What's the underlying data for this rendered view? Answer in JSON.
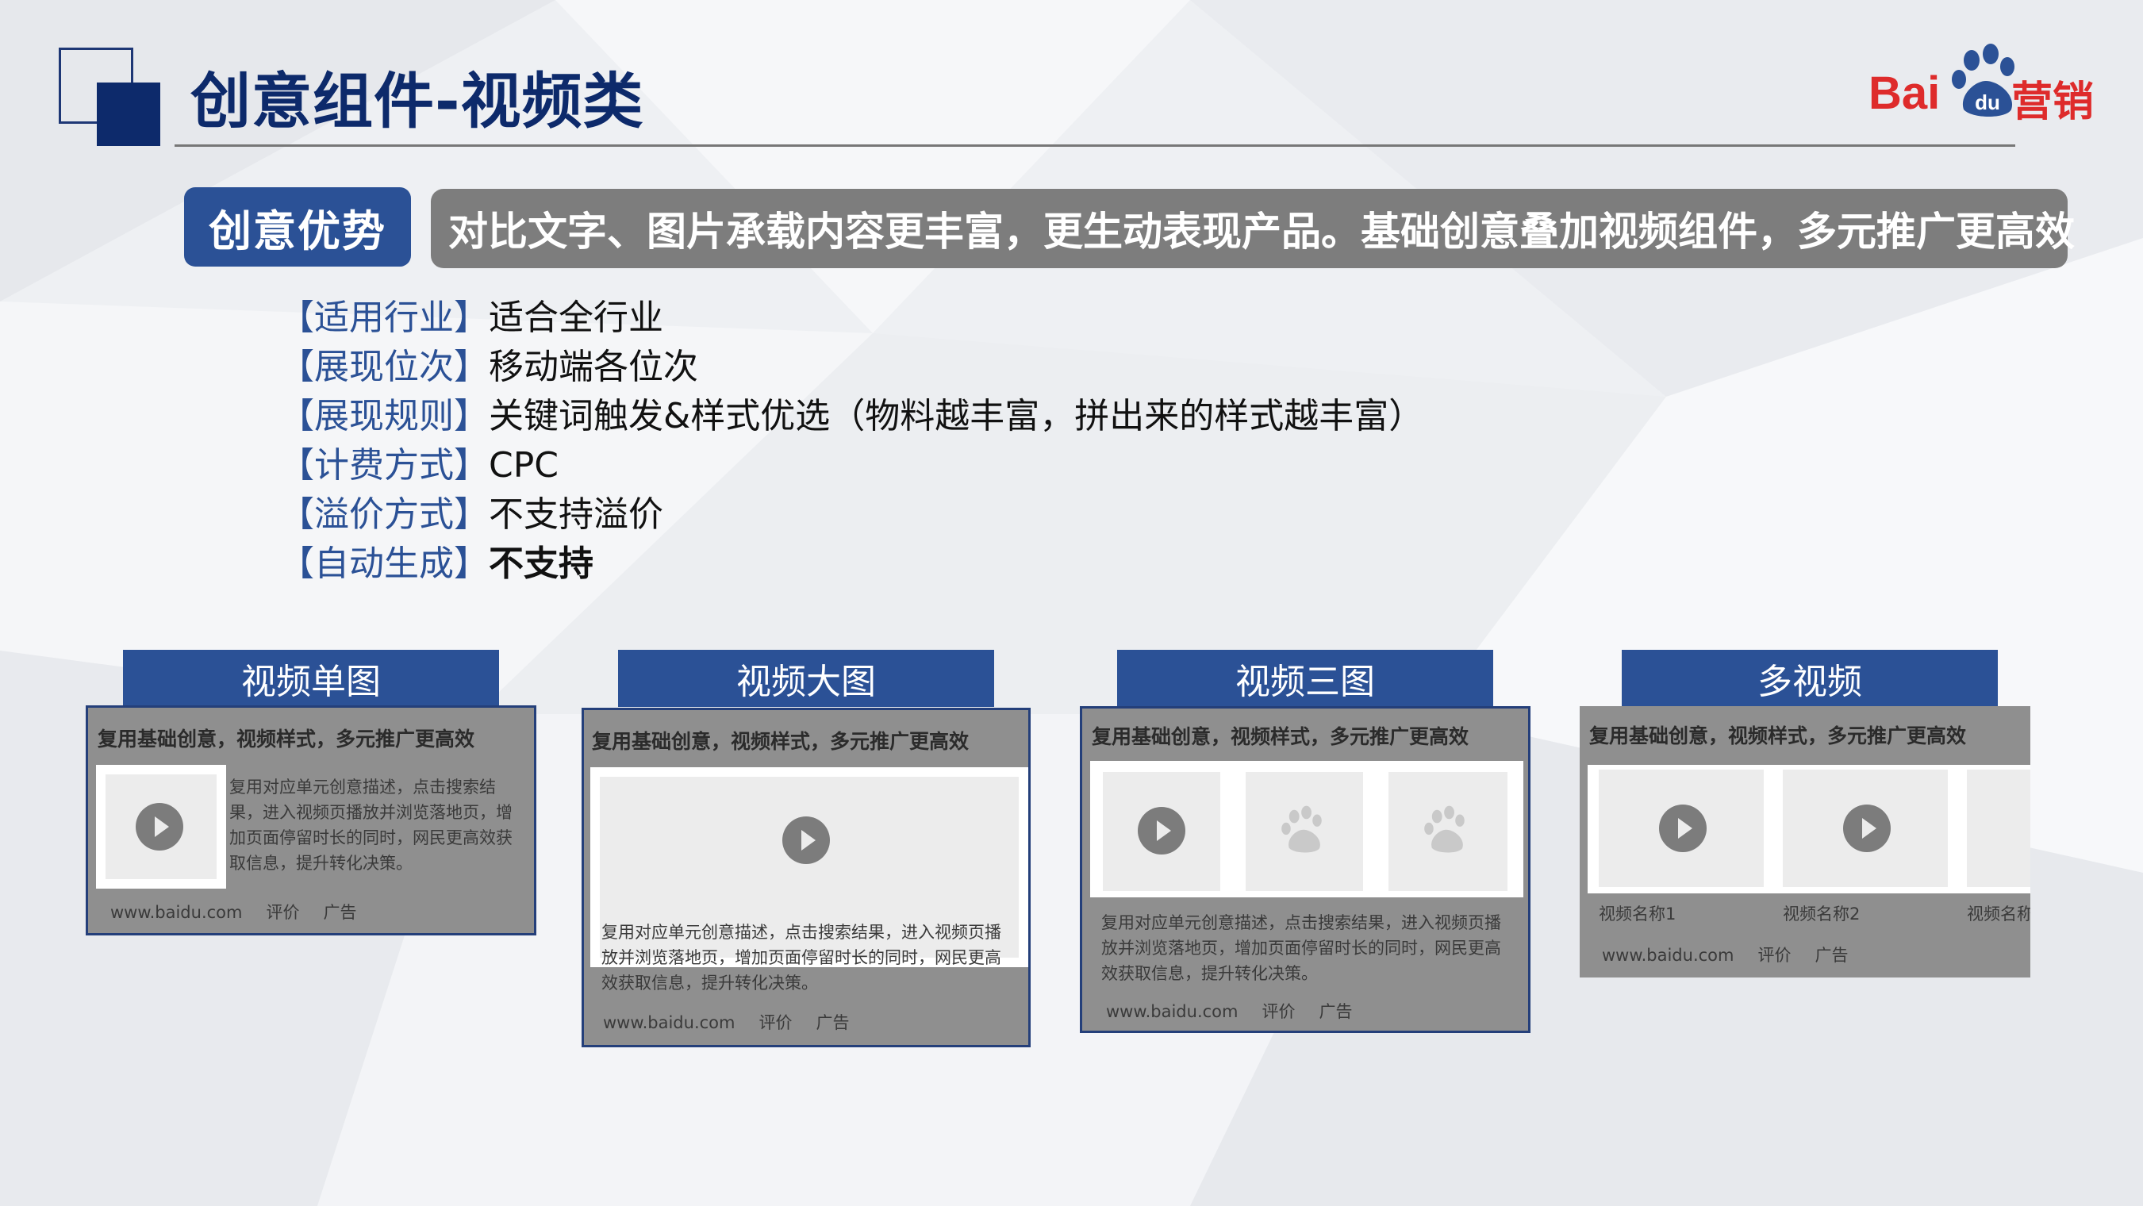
{
  "title": "创意组件-视频类",
  "logo": {
    "bai": "Bai",
    "du": "du",
    "ying": "营销"
  },
  "advantage": {
    "tag": "创意优势",
    "text": "对比文字、图片承载内容更丰富，更生动表现产品。基础创意叠加视频组件，多元推广更高效"
  },
  "specs": [
    {
      "label": "【适用行业】",
      "value": "适合全行业"
    },
    {
      "label": "【展现位次】",
      "value": "移动端各位次"
    },
    {
      "label": "【展现规则】",
      "value": "关键词触发&样式优选（物料越丰富，拼出来的样式越丰富）"
    },
    {
      "label": "【计费方式】",
      "value": "CPC"
    },
    {
      "label": "【溢价方式】",
      "value": "不支持溢价"
    },
    {
      "label": "【自动生成】",
      "value": "不支持"
    }
  ],
  "cards": [
    {
      "tab": "视频单图",
      "head": "复用基础创意，视频样式，多元推广更高效",
      "desc": "复用对应单元创意描述，点击搜索结果，进入视频页播放并浏览落地页，增加页面停留时长的同时，网民更高效获取信息，提升转化决策。",
      "foot": [
        "www.baidu.com",
        "评价",
        "广告"
      ]
    },
    {
      "tab": "视频大图",
      "head": "复用基础创意，视频样式，多元推广更高效",
      "desc": "复用对应单元创意描述，点击搜索结果，进入视频页播放并浏览落地页，增加页面停留时长的同时，网民更高效获取信息，提升转化决策。",
      "foot": [
        "www.baidu.com",
        "评价",
        "广告"
      ]
    },
    {
      "tab": "视频三图",
      "head": "复用基础创意，视频样式，多元推广更高效",
      "desc": "复用对应单元创意描述，点击搜索结果，进入视频页播放并浏览落地页，增加页面停留时长的同时，网民更高效获取信息，提升转化决策。",
      "foot": [
        "www.baidu.com",
        "评价",
        "广告"
      ]
    },
    {
      "tab": "多视频",
      "head": "复用基础创意，视频样式，多元推广更高效",
      "video_names": [
        "视频名称1",
        "视频名称2",
        "视频名称"
      ],
      "foot": [
        "www.baidu.com",
        "评价",
        "广告"
      ]
    }
  ]
}
